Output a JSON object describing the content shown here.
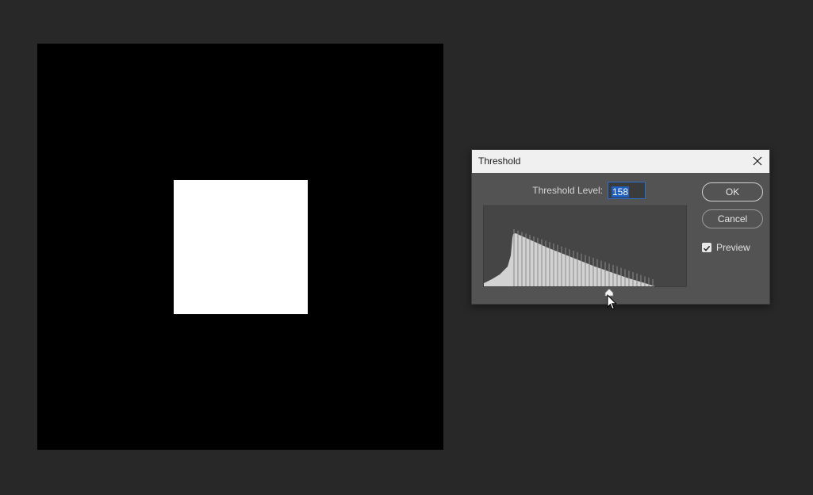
{
  "dialog": {
    "title": "Threshold",
    "threshold_label": "Threshold Level:",
    "threshold_value": "158",
    "ok_label": "OK",
    "cancel_label": "Cancel",
    "preview_label": "Preview",
    "preview_checked": true,
    "slider_level": 158,
    "slider_max": 255
  },
  "icons": {
    "close": "close-icon",
    "checkbox": "checkmark-icon",
    "slider": "slider-handle-icon",
    "cursor": "arrow-cursor-icon"
  },
  "colors": {
    "workspace": "#282828",
    "dialog_body": "#535353",
    "histogram_bg": "#454545",
    "histogram_fill": "#d2d2d2",
    "input_highlight": "#1f5fbf"
  }
}
